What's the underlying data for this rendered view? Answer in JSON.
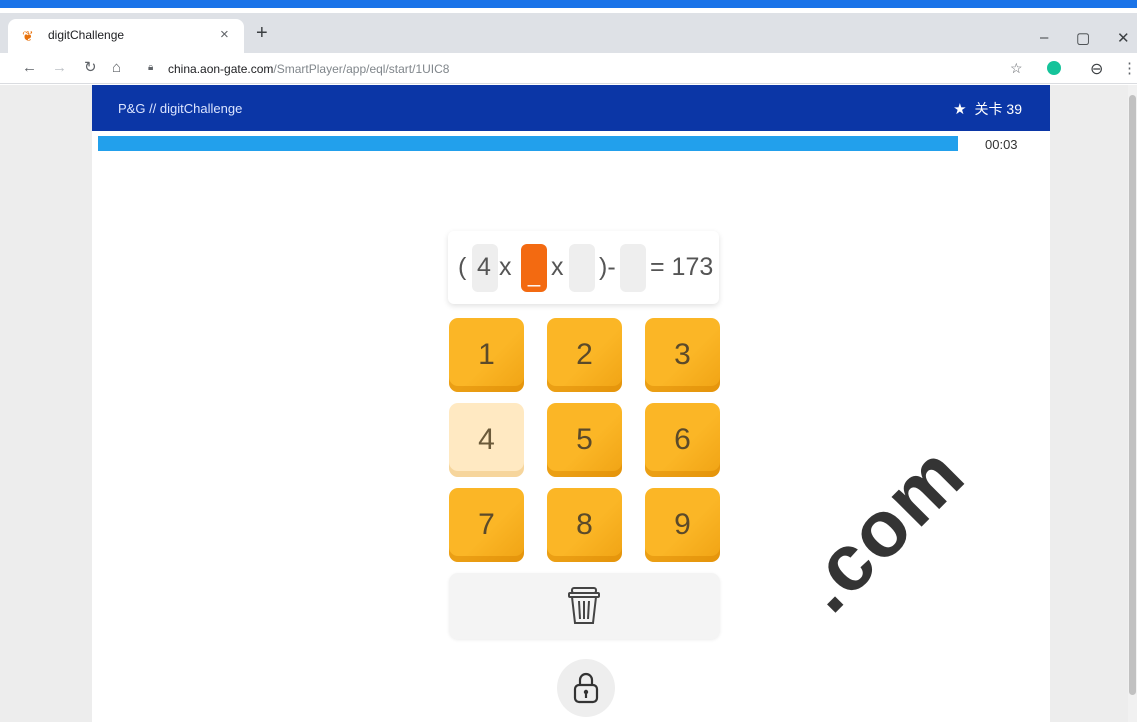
{
  "browser": {
    "tab_title": "digitChallenge",
    "tab_close": "×",
    "new_tab": "+",
    "url_host": "china.aon-gate.com",
    "url_path": "/SmartPlayer/app/eql/start/1UIC8",
    "icons": [
      "back-icon",
      "forward-icon",
      "reload-icon",
      "home-icon",
      "lock-icon",
      "bookmark-star-icon",
      "grammarly-icon",
      "profile-icon",
      "menu-icon"
    ]
  },
  "app": {
    "breadcrumb": "P&G  //  digitChallenge",
    "level_label": "关卡 39",
    "timer": "00:03",
    "progress": 1.0,
    "colors": {
      "header": "#0b36a6",
      "progress": "#22a0ec",
      "key": "#fbb626",
      "active_slot": "#f36a11"
    }
  },
  "equation": {
    "open_paren": "(",
    "n1": "4",
    "op1": "x",
    "active_placeholder": "_",
    "op2": "x",
    "close_minus": ")-",
    "result": "= 173"
  },
  "keypad": {
    "keys": [
      "1",
      "2",
      "3",
      "4",
      "5",
      "6",
      "7",
      "8",
      "9"
    ],
    "used_key": "4"
  },
  "controls": {
    "clear_icon": "trash-icon",
    "submit_icon": "lock-icon"
  },
  "watermark": ".com"
}
